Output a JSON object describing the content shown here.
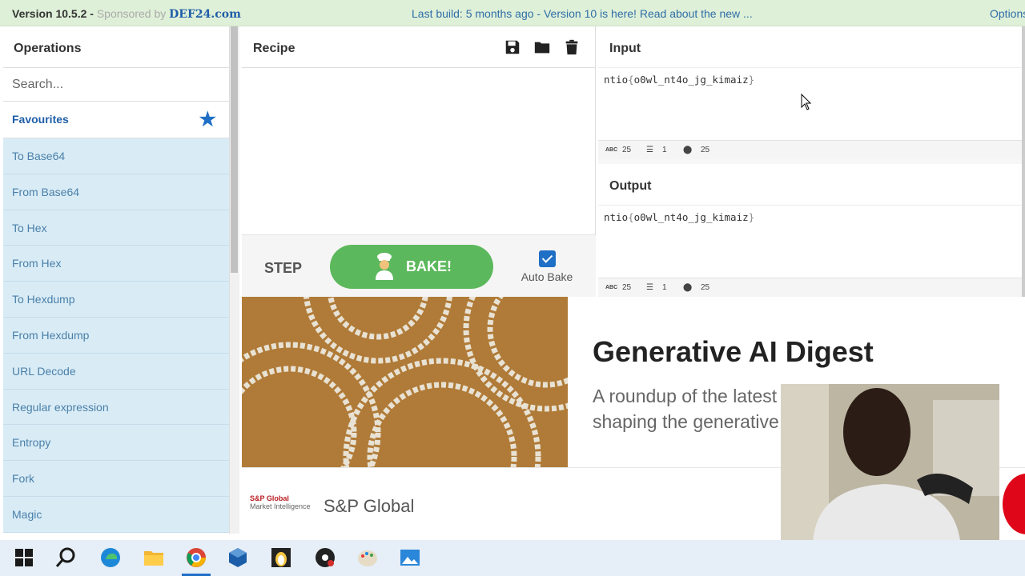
{
  "topbar": {
    "version": "Version 10.5.2 - ",
    "sponsor": "Sponsored by",
    "sponsor_site": "DEF24.com",
    "notice": "Last build: 5 months ago - Version 10 is here! Read about the new ...",
    "options": "Options"
  },
  "operations": {
    "title": "Operations",
    "search_placeholder": "Search...",
    "favourites": "Favourites",
    "items": [
      "To Base64",
      "From Base64",
      "To Hex",
      "From Hex",
      "To Hexdump",
      "From Hexdump",
      "URL Decode",
      "Regular expression",
      "Entropy",
      "Fork",
      "Magic"
    ]
  },
  "recipe": {
    "title": "Recipe",
    "step": "STEP",
    "bake": "BAKE!",
    "auto_bake": "Auto Bake",
    "auto_bake_checked": true
  },
  "input": {
    "title": "Input",
    "prefix": "ntio",
    "open_brace": "{",
    "body": "o0wl_nt4o_jg_kimaiz",
    "close_brace": "}",
    "length": "25",
    "lines": "1",
    "position": "25"
  },
  "output": {
    "title": "Output",
    "prefix": "ntio",
    "open_brace": "{",
    "body": "o0wl_nt4o_jg_kimaiz",
    "close_brace": "}",
    "length": "25",
    "lines": "1",
    "position": "25"
  },
  "ad": {
    "title": "Generative AI Digest",
    "description": "A roundup of the latest trends and developments shaping the generative AI landscape",
    "logo_line1": "S&P Global",
    "logo_line2": "Market Intelligence",
    "brand": "S&P Global"
  },
  "colors": {
    "accent": "#1f6fc6",
    "bake_green": "#5cb85c",
    "op_item_bg": "#d9ecf6",
    "topbar_bg": "#dff0d8"
  },
  "taskbar": {
    "icons": [
      "windows-start-icon",
      "search-icon",
      "edge-browser-icon",
      "file-explorer-icon",
      "chrome-browser-icon",
      "virtualbox-icon",
      "terminal-penguin-icon",
      "obs-studio-icon",
      "paint-icon",
      "photos-icon"
    ]
  }
}
